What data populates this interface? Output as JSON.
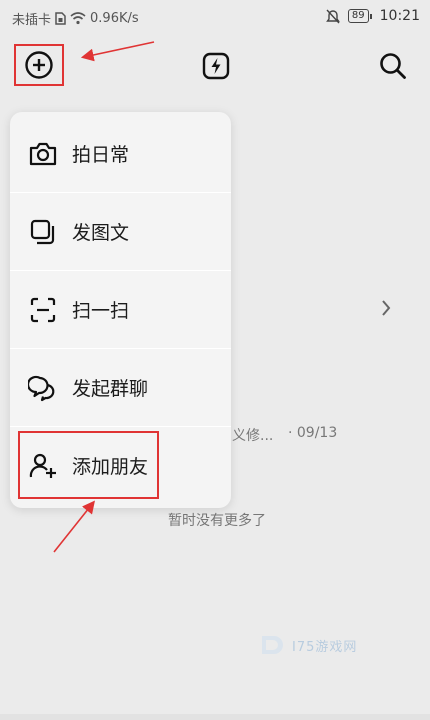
{
  "status_bar": {
    "sim": "未插卡",
    "speed": "0.96K/s",
    "battery": "89",
    "time": "10:21"
  },
  "toolbar": {
    "add_icon": "plus-circle-icon",
    "flash_icon": "lightning-icon",
    "search_icon": "search-icon"
  },
  "menu": {
    "items": [
      {
        "label": "拍日常",
        "icon": "camera-icon"
      },
      {
        "label": "发图文",
        "icon": "image-text-icon"
      },
      {
        "label": "扫一扫",
        "icon": "scan-icon"
      },
      {
        "label": "发起群聊",
        "icon": "group-chat-icon"
      },
      {
        "label": "添加朋友",
        "icon": "add-friend-icon"
      }
    ]
  },
  "feed": {
    "snippet": "义修...",
    "date": "· 09/13",
    "no_more": "暂时没有更多了"
  },
  "watermark": {
    "text": "I75游戏网"
  },
  "colors": {
    "annotation": "#e03434",
    "background": "#ebebeb",
    "menu_bg": "#f4f4f4"
  }
}
